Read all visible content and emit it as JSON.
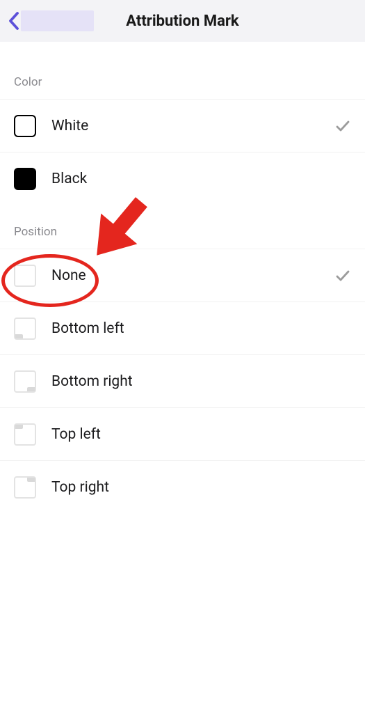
{
  "header": {
    "title": "Attribution Mark"
  },
  "sections": {
    "color": {
      "label": "Color",
      "options": {
        "white": "White",
        "black": "Black"
      },
      "selected": "white"
    },
    "position": {
      "label": "Position",
      "options": {
        "none": "None",
        "bottom_left": "Bottom left",
        "bottom_right": "Bottom right",
        "top_left": "Top left",
        "top_right": "Top right"
      },
      "selected": "none"
    }
  },
  "annotation": {
    "highlight": "position.none",
    "color": "#e4261e"
  }
}
